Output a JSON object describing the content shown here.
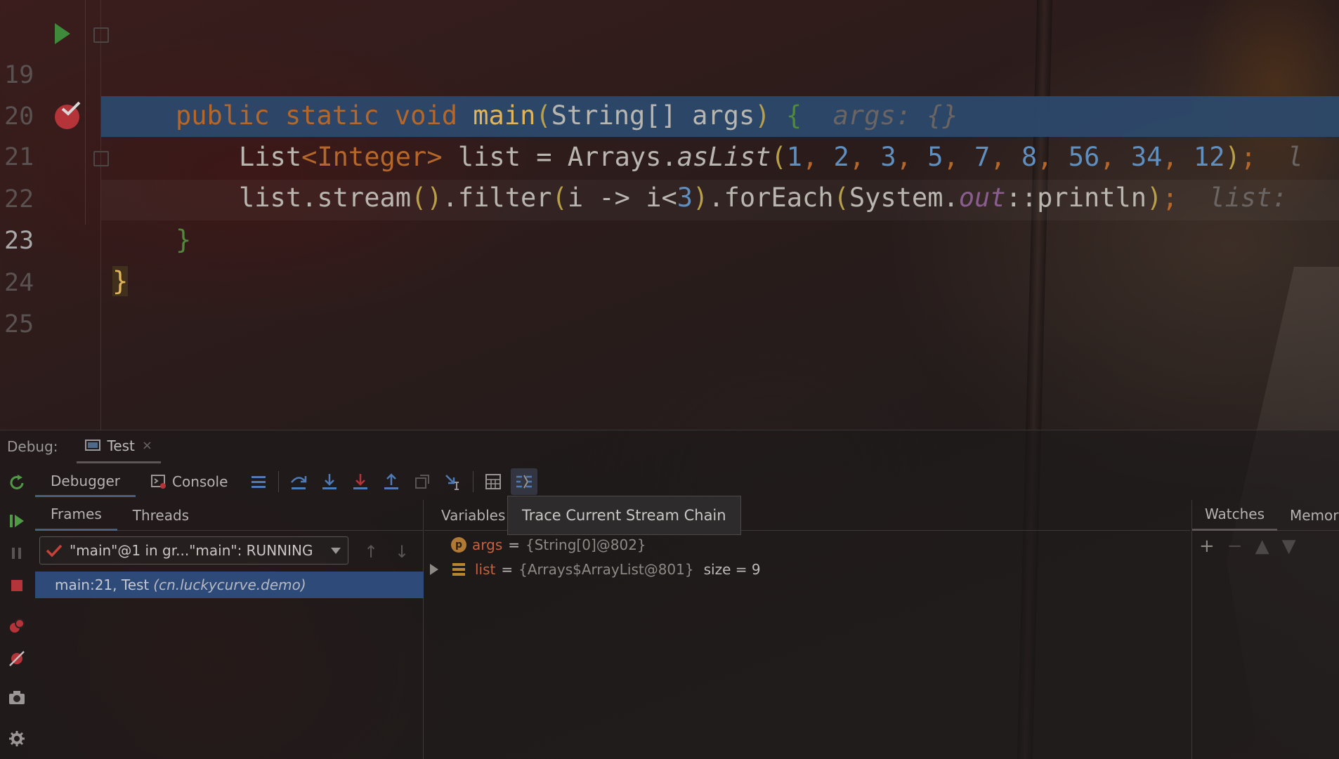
{
  "editor": {
    "lines": [
      {
        "no": "19"
      },
      {
        "no": "20"
      },
      {
        "no": "21"
      },
      {
        "no": "22"
      },
      {
        "no": "23"
      },
      {
        "no": "24"
      },
      {
        "no": "25"
      }
    ],
    "line19": {
      "kw_public": "public",
      "kw_static": "static",
      "kw_void": "void",
      "method": "main",
      "params_open": "(",
      "params": "String[] args",
      "params_close": ")",
      "brace": "{",
      "hint": "args: {}"
    },
    "line20": {
      "type_open": "List",
      "generic": "<Integer>",
      "decl": " list = Arrays.",
      "call": "asList",
      "paren_open": "(",
      "numbers": [
        "1",
        "2",
        "3",
        "5",
        "7",
        "8",
        "56",
        "34",
        "12"
      ],
      "paren_close": ")",
      "semi": ";",
      "hint": "l"
    },
    "line21": {
      "code_a": "list.stream",
      "paren_a": "()",
      "code_b": ".filter",
      "paren_b": "(",
      "code_c": "i -> i<",
      "num": "3",
      "paren_c": ")",
      "code_d": ".forEach",
      "paren_d": "(",
      "code_e": "System.",
      "field": "out",
      "code_f": "::println",
      "paren_e": ")",
      "semi": ";",
      "hint": "list:"
    },
    "line22": {
      "brace": "}"
    },
    "line23": {
      "brace": "}"
    }
  },
  "debug": {
    "label": "Debug:",
    "session_tab": "Test",
    "session_close": "×",
    "toolbar": {
      "debugger_tab": "Debugger",
      "console_tab": "Console"
    },
    "frames": {
      "tab_frames": "Frames",
      "tab_threads": "Threads",
      "thread_value": "\"main\"@1 in gr...\"main\": RUNNING",
      "frame_method": "main:21, Test",
      "frame_package": "(cn.luckycurve.demo)"
    },
    "variables": {
      "title": "Variables",
      "tooltip": "Trace Current Stream Chain",
      "rows": [
        {
          "badge": "p",
          "name": "args",
          "eq": "=",
          "value": "{String[0]@802}",
          "extra": ""
        },
        {
          "badge": "",
          "name": "list",
          "eq": "=",
          "value": "{Arrays$ArrayList@801}",
          "extra": "size = 9"
        }
      ]
    },
    "watches": {
      "tab_watches": "Watches",
      "tab_memory": "Memor",
      "add": "+",
      "remove": "−"
    }
  },
  "colors": {
    "exec_line": "#2c4a6e",
    "keyword": "#b5672a",
    "number": "#5e8fbf",
    "selected_frame": "#2e4a78"
  }
}
